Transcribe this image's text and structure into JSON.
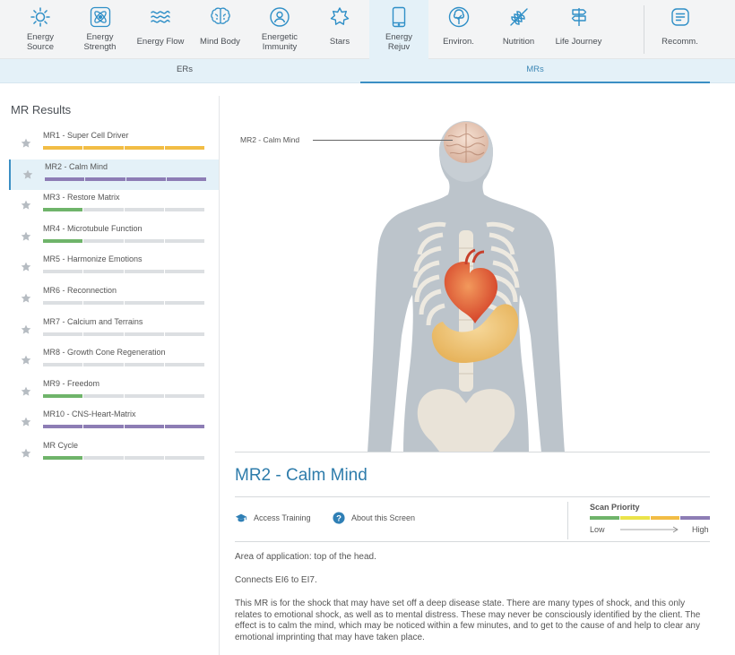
{
  "nav": {
    "items": [
      {
        "id": "energy-source",
        "label": "Energy\nSource",
        "icon": "sun-icon"
      },
      {
        "id": "energy-strength",
        "label": "Energy\nStrength",
        "icon": "atom-icon"
      },
      {
        "id": "energy-flow",
        "label": "Energy Flow",
        "icon": "waves-icon"
      },
      {
        "id": "mind-body",
        "label": "Mind Body",
        "icon": "brain-icon"
      },
      {
        "id": "energetic-immunity",
        "label": "Energetic\nImmunity",
        "icon": "shield-person-icon"
      },
      {
        "id": "stars",
        "label": "Stars",
        "icon": "star-burst-icon"
      },
      {
        "id": "energy-rejuv",
        "label": "Energy\nRejuv",
        "icon": "tablet-icon"
      },
      {
        "id": "environ",
        "label": "Environ.",
        "icon": "tree-icon"
      },
      {
        "id": "nutrition",
        "label": "Nutrition",
        "icon": "wheat-icon"
      },
      {
        "id": "life-journey",
        "label": "Life Journey",
        "icon": "signpost-icon"
      },
      {
        "id": "recomm",
        "label": "Recomm.",
        "icon": "clipboard-icon"
      }
    ],
    "active": "energy-rejuv"
  },
  "subtabs": {
    "ers": "ERs",
    "mrs": "MRs",
    "active": "mrs"
  },
  "sidebar": {
    "title": "MR Results",
    "items": [
      {
        "label": "MR1 - Super Cell Driver",
        "segments": 4,
        "color": "#f2bd45"
      },
      {
        "label": "MR2 - Calm Mind",
        "segments": 5,
        "color": "#8d7db5"
      },
      {
        "label": "MR3 - Restore Matrix",
        "segments": 1,
        "color": "#6fb46a"
      },
      {
        "label": "MR4 - Microtubule Function",
        "segments": 1,
        "color": "#6fb46a"
      },
      {
        "label": "MR5 - Harmonize Emotions",
        "segments": 0,
        "color": "#6fb46a"
      },
      {
        "label": "MR6 - Reconnection",
        "segments": 0,
        "color": "#6fb46a"
      },
      {
        "label": "MR7 - Calcium and Terrains",
        "segments": 0,
        "color": "#6fb46a"
      },
      {
        "label": "MR8 - Growth Cone Regeneration",
        "segments": 0,
        "color": "#6fb46a"
      },
      {
        "label": "MR9 - Freedom",
        "segments": 1,
        "color": "#6fb46a"
      },
      {
        "label": "MR10 - CNS-Heart-Matrix",
        "segments": 5,
        "color": "#8d7db5"
      },
      {
        "label": "MR Cycle",
        "segments": 1,
        "color": "#6fb46a"
      }
    ],
    "selected": 1
  },
  "detail": {
    "callout": "MR2 - Calm Mind",
    "title": "MR2 - Calm Mind",
    "access_training": "Access Training",
    "about_screen": "About this Screen",
    "scan_priority": {
      "title": "Scan Priority",
      "low": "Low",
      "high": "High",
      "colors": [
        "#6fb46a",
        "#ebe34a",
        "#f2bd45",
        "#8d7db5"
      ]
    },
    "paragraphs": [
      "Area of application: top of the head.",
      "Connects EI6 to EI7.",
      "This MR is for the shock that may have set off a deep disease state. There are many types of shock, and this only relates to emotional shock, as well as to mental distress. These may never be consciously identified by the client. The effect is to calm the mind, which may be noticed within a few minutes, and to get to the cause of and help to clear any emotional imprinting that may have taken place."
    ]
  }
}
